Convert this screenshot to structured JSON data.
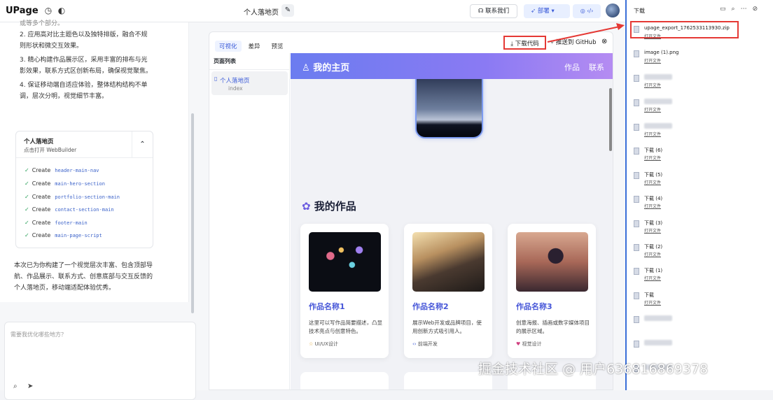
{
  "app": {
    "logo": "UPage",
    "title": "个人落地页",
    "contact_label": "联系我们",
    "deploy_label": "部署",
    "mini_label": "◎ ‹/›"
  },
  "chat": {
    "cut_text": "或等多个部分。",
    "items": [
      "2. 应用高对比主题色以及独特排版，融合不规则形状和微交互效果。",
      "3. 精心构建作品展示区，采用丰富的排布与光影效果，联系方式区创新布局，确保视觉聚焦。",
      "4. 保证移动端自适应体验，整体结构结构不单调，层次分明，视觉细节丰富。"
    ],
    "card": {
      "title": "个人落地页",
      "subtitle": "点击打开 WebBuilder",
      "tasks": [
        {
          "verb": "Create",
          "code": "header-main-nav"
        },
        {
          "verb": "Create",
          "code": "main-hero-section"
        },
        {
          "verb": "Create",
          "code": "portfolio-section-main"
        },
        {
          "verb": "Create",
          "code": "contact-section-main"
        },
        {
          "verb": "Create",
          "code": "footer-main"
        },
        {
          "verb": "Create",
          "code": "main-page-script"
        }
      ]
    },
    "summary": "本次已为你构建了一个视觉层次丰富、包含顶部导航、作品展示、联系方式、创意底部与交互反馈的个人落地页，移动端适配体验优秀。",
    "input_placeholder": "需要我优化哪些地方？"
  },
  "preview": {
    "tabs": [
      "可视化",
      "差异",
      "预览"
    ],
    "download_label": "下载代码",
    "push_label": "推送到 GitHub",
    "page_list_header": "页面列表",
    "page_item_name": "个人落地页",
    "page_item_sub": "index"
  },
  "site": {
    "brand": "我的主页",
    "nav_links": [
      "作品",
      "联系"
    ],
    "works_title": "我的作品",
    "works": [
      {
        "name": "作品名称1",
        "desc": "这里可以写作品简要描述，凸显技术亮点与创意特色。",
        "tag": "UI/UX设计"
      },
      {
        "name": "作品名称2",
        "desc": "展示Web开发或品牌项目，使用创新方式吸引用人。",
        "tag": "前端开发"
      },
      {
        "name": "作品名称3",
        "desc": "创意海报、插画或数字媒体项目的展示区域。",
        "tag": "视觉设计"
      }
    ]
  },
  "downloads": {
    "title": "下载",
    "items": [
      {
        "name": "upage_export_1762533113930.zip",
        "open": "打开文件",
        "blurred": false
      },
      {
        "name": "image (1).png",
        "open": "打开文件",
        "blurred": false
      },
      {
        "name": "",
        "open": "打开文件",
        "blurred": true
      },
      {
        "name": "",
        "open": "打开文件",
        "blurred": true
      },
      {
        "name": "",
        "open": "打开文件",
        "blurred": true
      },
      {
        "name": "下载 (6)",
        "open": "打开文件",
        "blurred": false
      },
      {
        "name": "下载 (5)",
        "open": "打开文件",
        "blurred": false
      },
      {
        "name": "下载 (4)",
        "open": "打开文件",
        "blurred": false
      },
      {
        "name": "下载 (3)",
        "open": "打开文件",
        "blurred": false
      },
      {
        "name": "下载 (2)",
        "open": "打开文件",
        "blurred": false
      },
      {
        "name": "下载 (1)",
        "open": "打开文件",
        "blurred": false
      },
      {
        "name": "下载",
        "open": "打开文件",
        "blurred": false
      },
      {
        "name": "",
        "open": "",
        "blurred": true
      },
      {
        "name": "",
        "open": "",
        "blurred": true
      },
      {
        "name": "",
        "open": "",
        "blurred": true
      }
    ]
  },
  "watermark": "掘金技术社区 @ 用户636816869378",
  "colors": {
    "accent": "#3a5ad8",
    "highlight": "#e53935",
    "nav_gradient_start": "#6b7cf0",
    "nav_gradient_end": "#b58cf2"
  }
}
